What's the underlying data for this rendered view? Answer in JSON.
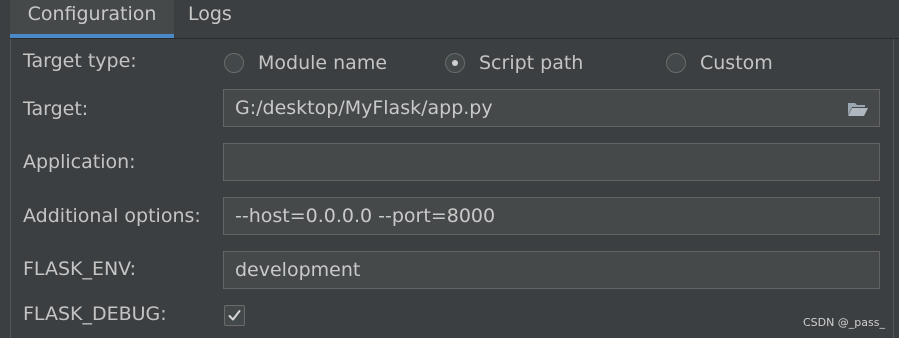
{
  "tabs": [
    {
      "label": "Configuration",
      "active": true
    },
    {
      "label": "Logs",
      "active": false
    }
  ],
  "form": {
    "target_type": {
      "label": "Target type:",
      "options": [
        "Module name",
        "Script path",
        "Custom"
      ],
      "selected": "Script path"
    },
    "target": {
      "label": "Target:",
      "value": "G:/desktop/MyFlask/app.py",
      "icon": "folder-icon"
    },
    "application": {
      "label": "Application:",
      "value": ""
    },
    "additional_options": {
      "label": "Additional options:",
      "value": "--host=0.0.0.0 --port=8000"
    },
    "flask_env": {
      "label": "FLASK_ENV:",
      "value": "development"
    },
    "flask_debug": {
      "label": "FLASK_DEBUG:",
      "checked": true
    }
  },
  "watermark": "CSDN @_pass_",
  "colors": {
    "background": "#3c3f41",
    "field_background": "#45494a",
    "accent": "#4a88c7",
    "text": "#c4c4c4"
  }
}
